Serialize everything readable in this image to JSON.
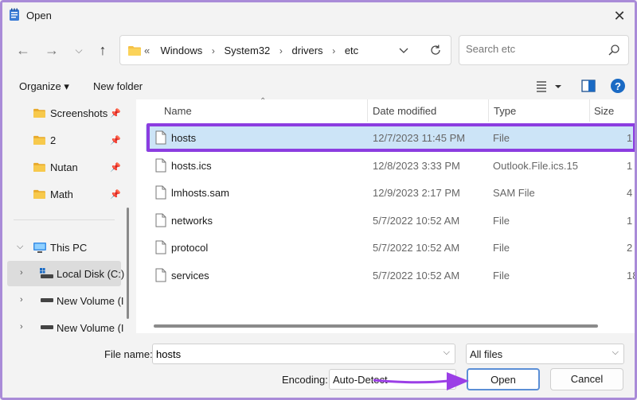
{
  "window": {
    "title": "Open",
    "close_symbol": "✕"
  },
  "address": {
    "overflow": "«",
    "crumbs": [
      "Windows",
      "System32",
      "drivers",
      "etc"
    ]
  },
  "search": {
    "placeholder": "Search etc"
  },
  "toolbar": {
    "organize_label": "Organize ▾",
    "new_folder_label": "New folder"
  },
  "sidebar": {
    "pinned": [
      {
        "label": "Screenshots"
      },
      {
        "label": "2"
      },
      {
        "label": "Nutan"
      },
      {
        "label": "Math"
      }
    ],
    "this_pc": "This PC",
    "drives": [
      {
        "label": "Local Disk (C:)"
      },
      {
        "label": "New Volume (I"
      },
      {
        "label": "New Volume (I"
      }
    ]
  },
  "columns": {
    "name": "Name",
    "date": "Date modified",
    "type": "Type",
    "size": "Size"
  },
  "files": [
    {
      "name": "hosts",
      "date": "12/7/2023 11:45 PM",
      "type": "File",
      "size": "1"
    },
    {
      "name": "hosts.ics",
      "date": "12/8/2023 3:33 PM",
      "type": "Outlook.File.ics.15",
      "size": "1"
    },
    {
      "name": "lmhosts.sam",
      "date": "12/9/2023 2:17 PM",
      "type": "SAM File",
      "size": "4"
    },
    {
      "name": "networks",
      "date": "5/7/2022 10:52 AM",
      "type": "File",
      "size": "1"
    },
    {
      "name": "protocol",
      "date": "5/7/2022 10:52 AM",
      "type": "File",
      "size": "2"
    },
    {
      "name": "services",
      "date": "5/7/2022 10:52 AM",
      "type": "File",
      "size": "18"
    }
  ],
  "selected_file": "hosts",
  "bottom": {
    "file_name_label": "File name:",
    "file_name_value": "hosts",
    "filter_value": "All files",
    "encoding_label": "Encoding:",
    "encoding_value": "Auto-Detect",
    "open_label": "Open",
    "cancel_label": "Cancel"
  },
  "colors": {
    "highlight": "#8c3de0",
    "selection": "#cce4f7",
    "accent": "#0067c0"
  }
}
